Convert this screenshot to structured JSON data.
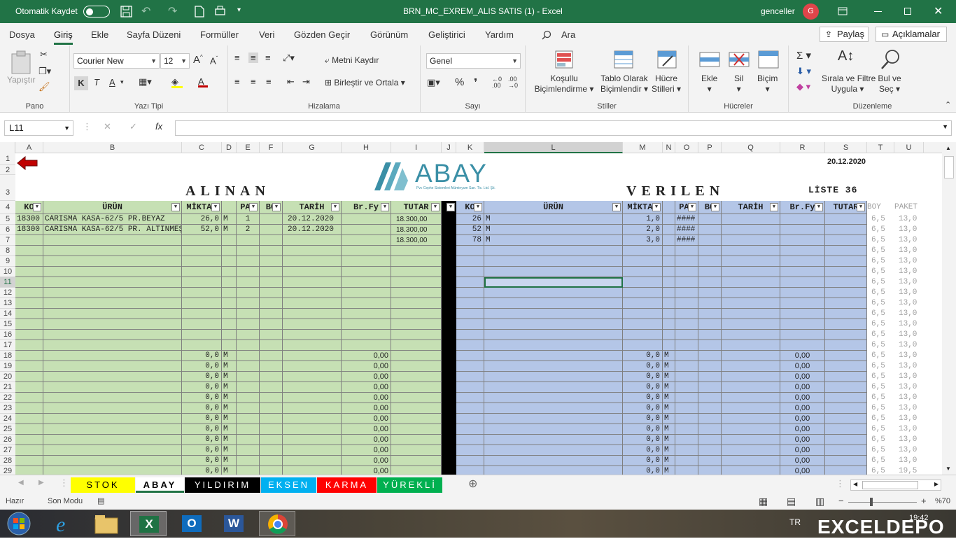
{
  "titlebar": {
    "autosave_label": "Otomatik Kaydet",
    "filename": "BRN_MC_EXREM_ALIS SATIS (1)  -  Excel",
    "user": "genceller",
    "avatar_letter": "G"
  },
  "tabs": [
    "Dosya",
    "Giriş",
    "Ekle",
    "Sayfa Düzeni",
    "Formüller",
    "Veri",
    "Gözden Geçir",
    "Görünüm",
    "Geliştirici",
    "Yardım"
  ],
  "search_label": "Ara",
  "share_label": "Paylaş",
  "comments_label": "Açıklamalar",
  "ribbon": {
    "pano": {
      "paste": "Yapıştır",
      "label": "Pano"
    },
    "font": {
      "name": "Courier New",
      "size": "12",
      "bold": "K",
      "italic": "T",
      "underline": "A",
      "label": "Yazı Tipi"
    },
    "align": {
      "wrap": "Metni Kaydır",
      "merge": "Birleştir ve Ortala",
      "label": "Hizalama"
    },
    "number": {
      "format": "Genel",
      "label": "Sayı"
    },
    "styles": {
      "cond1": "Koşullu",
      "cond2": "Biçimlendirme",
      "table1": "Tablo Olarak",
      "table2": "Biçimlendir",
      "cell1": "Hücre",
      "cell2": "Stilleri",
      "label": "Stiller"
    },
    "cells": {
      "insert": "Ekle",
      "delete": "Sil",
      "format": "Biçim",
      "label": "Hücreler"
    },
    "editing": {
      "sort1": "Sırala ve Filtre",
      "sort2": "Uygula",
      "find1": "Bul ve",
      "find2": "Seç",
      "label": "Düzenleme"
    }
  },
  "namebox": "L11",
  "columns": [
    "A",
    "B",
    "C",
    "D",
    "E",
    "F",
    "G",
    "H",
    "I",
    "J",
    "K",
    "L",
    "M",
    "N",
    "O",
    "P",
    "Q",
    "R",
    "S",
    "T",
    "U"
  ],
  "sheet": {
    "date": "20.12.2020",
    "logo": "ABAY",
    "logo_sub": "Pvc Cephe Sistemleri Alüminyum San. Tic. Ltd. Şti.",
    "alinan": "ALINAN",
    "verilen": "VERILEN",
    "liste": "LİSTE 36",
    "left_headers": [
      "KO",
      "ÜRÜN",
      "MİKTAR",
      "",
      "PAI",
      "BO",
      "TARİH",
      "Br.Fy",
      "TUTAR"
    ],
    "right_headers": [
      "KO",
      "ÜRÜN",
      "MİKTAR",
      "",
      "PAI",
      "BO",
      "TARİH",
      "Br.Fy",
      "TUTAR"
    ],
    "boy_label": "BOY",
    "paket_label": "PAKET",
    "left_rows": [
      {
        "ko": "18300",
        "urun": "CARISMA KASA-62/5 PR.BEYAZ",
        "miktar": "26,0",
        "unit": "M",
        "pai": "1",
        "tarih": "20.12.2020",
        "tutar": "18.300,00"
      },
      {
        "ko": "18300",
        "urun": "CARISMA KASA-62/5 PR. ALTINMEŞE",
        "miktar": "52,0",
        "unit": "M",
        "pai": "2",
        "tarih": "20.12.2020",
        "tutar": "18.300,00"
      },
      {
        "tutar": "18.300,00"
      }
    ],
    "right_rows": [
      {
        "ko": "26",
        "unit": "M",
        "miktar": "1,0",
        "pai": "####"
      },
      {
        "ko": "52",
        "unit": "M",
        "miktar": "2,0",
        "pai": "####"
      },
      {
        "ko": "78",
        "unit": "M",
        "miktar": "3,0",
        "pai": "####"
      }
    ],
    "zero_miktar": "0,0",
    "zero_unit": "M",
    "zero_price": "0,00",
    "boy_value": "6,5",
    "paket_value": "13,0",
    "paket_last": "19,5"
  },
  "sheet_tabs": [
    {
      "name": "STOK",
      "bg": "#ffff00",
      "fg": "#000000"
    },
    {
      "name": "ABAY",
      "bg": "#ffffff",
      "fg": "#000000"
    },
    {
      "name": "YILDIRIM",
      "bg": "#000000",
      "fg": "#ffffff"
    },
    {
      "name": "EKSEN",
      "bg": "#00b0f0",
      "fg": "#ffffff"
    },
    {
      "name": "KARMA",
      "bg": "#ff0000",
      "fg": "#ffffff"
    },
    {
      "name": "YÜREKLİ",
      "bg": "#00b050",
      "fg": "#ffffff"
    }
  ],
  "status": {
    "ready": "Hazır",
    "mode": "Son Modu",
    "zoom": "%70"
  },
  "taskbar": {
    "lang": "TR",
    "time": "19:42",
    "watermark": "EXCELDEPO"
  }
}
